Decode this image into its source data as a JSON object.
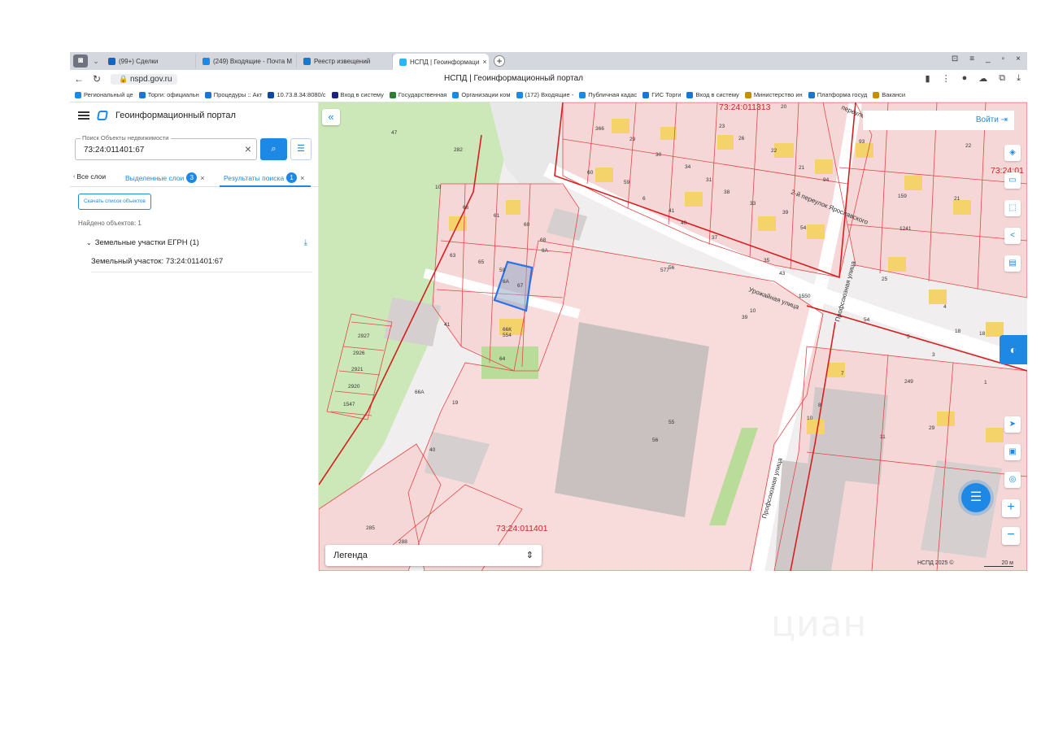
{
  "browser": {
    "tabs": [
      {
        "label": "(99+) Сделки",
        "color": "#2e7d32"
      },
      {
        "label": "(249) Входящие - Почта М",
        "color": "#1e88e5"
      },
      {
        "label": "Реестр извещений",
        "color": "#1e88e5"
      },
      {
        "label": "НСПД | Геоинформаци",
        "color": "#1e88e5",
        "active": true
      }
    ],
    "url": "nspd.gov.ru",
    "page_title": "НСПД | Геоинформационный портал",
    "bookmarks": [
      {
        "label": "Региональный це",
        "color": "#1e88e5"
      },
      {
        "label": "Торги: официальн",
        "color": "#1976d2"
      },
      {
        "label": "Процедуры :: Акт",
        "color": "#1976d2"
      },
      {
        "label": "10.73.8.34:8080/с",
        "color": "#0d47a1"
      },
      {
        "label": "Вход в систему",
        "color": "#1a237e"
      },
      {
        "label": "Государственная",
        "color": "#2e7d32"
      },
      {
        "label": "Организации ком",
        "color": "#1e88e5"
      },
      {
        "label": "(172) Входящие -",
        "color": "#1e88e5"
      },
      {
        "label": "Публичная кадас",
        "color": "#1e88e5"
      },
      {
        "label": "ГИС Торги",
        "color": "#1976d2"
      },
      {
        "label": "Вход в систему",
        "color": "#1976d2"
      },
      {
        "label": "Министерство ин",
        "color": "#c49000"
      },
      {
        "label": "Платформа госуд",
        "color": "#1976d2"
      },
      {
        "label": "Ваканси",
        "color": "#c49000"
      }
    ]
  },
  "sidebar": {
    "title": "Геоинформационный портал",
    "search_label": "Поиск Объекты недвижимости",
    "search_value": "73:24:011401:67",
    "tab_all": "Все слои",
    "tab_selected": "Выделенные слои",
    "tab_selected_count": "3",
    "tab_results": "Результаты поиска",
    "tab_results_count": "1",
    "download_label": "Скачать список объектов",
    "found_label": "Найдено объектов: 1",
    "group_label": "Земельные участки ЕГРН (1)",
    "item_label": "Земельный участок: 73:24:011401:67"
  },
  "map": {
    "login_label": "Войти",
    "legend_label": "Легенда",
    "copyright": "НСПД 2025 ©",
    "scale": "20 м",
    "quarter_labels": [
      "73:24:011313",
      "73:24:011401",
      "73:24:01"
    ],
    "street_labels": [
      "2-й переулок Ярославского",
      "Урожайная улица",
      "Профсоюзная улица",
      "переулок",
      "Профсоюзная улица"
    ],
    "selected_parcel": "67",
    "colors": {
      "parcel_line": "#e04848",
      "quarter_line": "#d62020",
      "selected": "#2a74e8",
      "building": "#f4d36b"
    }
  },
  "watermark": "циан"
}
